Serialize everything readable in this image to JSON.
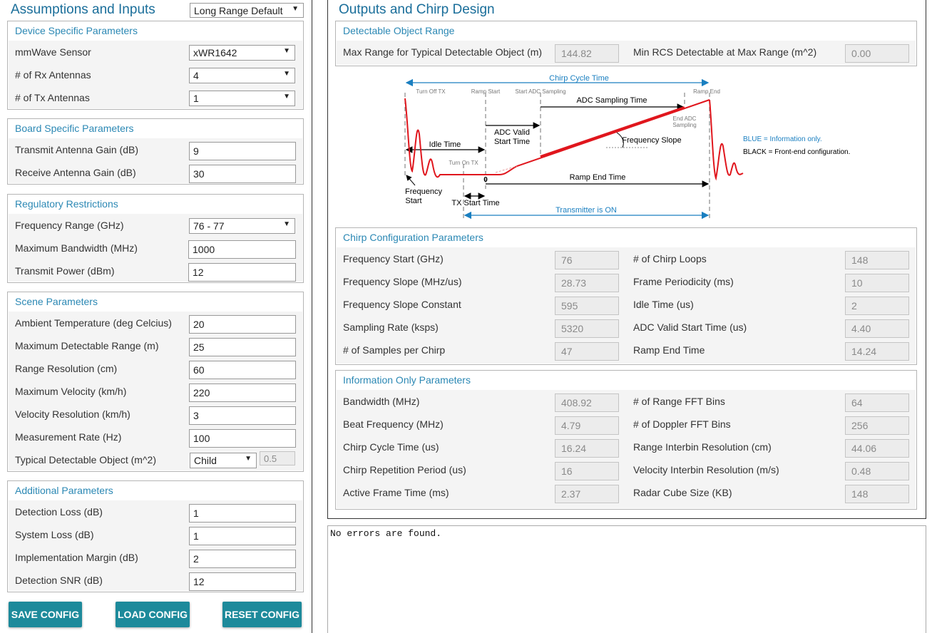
{
  "left": {
    "title": "Assumptions and Inputs",
    "preset": "Long Range Default",
    "device": {
      "title": "Device Specific Parameters",
      "sensor_label": "mmWave Sensor",
      "sensor": "xWR1642",
      "rx_label": "# of Rx Antennas",
      "rx": "4",
      "tx_label": "# of Tx Antennas",
      "tx": "1"
    },
    "board": {
      "title": "Board Specific Parameters",
      "tx_gain_label": "Transmit Antenna Gain (dB)",
      "tx_gain": "9",
      "rx_gain_label": "Receive Antenna Gain (dB)",
      "rx_gain": "30"
    },
    "regulatory": {
      "title": "Regulatory Restrictions",
      "freq_label": "Frequency Range (GHz)",
      "freq": "76 - 77",
      "bw_label": "Maximum Bandwidth (MHz)",
      "bw": "1000",
      "power_label": "Transmit Power (dBm)",
      "power": "12"
    },
    "scene": {
      "title": "Scene Parameters",
      "temp_label": "Ambient Temperature (deg Celcius)",
      "temp": "20",
      "range_label": "Maximum Detectable Range (m)",
      "range": "25",
      "res_label": "Range Resolution (cm)",
      "res": "60",
      "vel_label": "Maximum Velocity (km/h)",
      "vel": "220",
      "velres_label": "Velocity Resolution (km/h)",
      "velres": "3",
      "rate_label": "Measurement Rate (Hz)",
      "rate": "100",
      "obj_label": "Typical Detectable Object (m^2)",
      "obj": "Child",
      "obj_rcs": "0.5"
    },
    "additional": {
      "title": "Additional Parameters",
      "det_loss_label": "Detection Loss (dB)",
      "det_loss": "1",
      "sys_loss_label": "System Loss (dB)",
      "sys_loss": "1",
      "impl_label": "Implementation Margin (dB)",
      "impl": "2",
      "snr_label": "Detection SNR (dB)",
      "snr": "12"
    },
    "buttons": {
      "save": "SAVE CONFIG",
      "load": "LOAD CONFIG",
      "reset": "RESET CONFIG"
    }
  },
  "right": {
    "title": "Outputs and Chirp Design",
    "range": {
      "title": "Detectable Object Range",
      "max_range_label": "Max Range for Typical Detectable Object (m)",
      "max_range": "144.82",
      "min_rcs_label": "Min RCS Detectable at Max Range (m^2)",
      "min_rcs": "0.00"
    },
    "diagram": {
      "chirp_cycle": "Chirp Cycle Time",
      "turn_off_tx": "Turn Off TX",
      "ramp_start": "Ramp Start",
      "start_adc": "Start ADC Sampling",
      "ramp_end": "Ramp End",
      "adc_sampling": "ADC Sampling Time",
      "end_adc_1": "End ADC",
      "end_adc_2": "Sampling",
      "adc_valid_1": "ADC Valid",
      "adc_valid_2": "Start Time",
      "idle_time": "Idle Time",
      "freq_slope": "Frequency Slope",
      "turn_on_tx": "Turn On TX",
      "zero": "0",
      "ramp_end_time": "Ramp End Time",
      "freq_start_1": "Frequency",
      "freq_start_2": "Start",
      "tx_start": "TX Start Time",
      "tx_on": "Transmitter is ON",
      "legend_blue": "BLUE = Information only.",
      "legend_black": "BLACK = Front-end configuration.",
      "colors": {
        "blue": "#1a7fc0",
        "red": "#e0161d"
      }
    },
    "chirp": {
      "title": "Chirp Configuration Parameters",
      "rows": [
        {
          "l1": "Frequency Start (GHz)",
          "v1": "76",
          "l2": "# of Chirp Loops",
          "v2": "148"
        },
        {
          "l1": "Frequency Slope (MHz/us)",
          "v1": "28.73",
          "l2": "Frame Periodicity (ms)",
          "v2": "10"
        },
        {
          "l1": "Frequency Slope Constant",
          "v1": "595",
          "l2": "Idle Time (us)",
          "v2": "2"
        },
        {
          "l1": "Sampling Rate (ksps)",
          "v1": "5320",
          "l2": "ADC Valid Start Time (us)",
          "v2": "4.40"
        },
        {
          "l1": "# of Samples per Chirp",
          "v1": "47",
          "l2": "Ramp End Time",
          "v2": "14.24"
        }
      ]
    },
    "info": {
      "title": "Information Only Parameters",
      "rows": [
        {
          "l1": "Bandwidth (MHz)",
          "v1": "408.92",
          "l2": "# of Range FFT Bins",
          "v2": "64"
        },
        {
          "l1": "Beat Frequency (MHz)",
          "v1": "4.79",
          "l2": "# of Doppler FFT Bins",
          "v2": "256"
        },
        {
          "l1": "Chirp Cycle Time (us)",
          "v1": "16.24",
          "l2": "Range Interbin Resolution (cm)",
          "v2": "44.06"
        },
        {
          "l1": "Chirp Repetition Period (us)",
          "v1": "16",
          "l2": "Velocity Interbin Resolution (m/s)",
          "v2": "0.48"
        },
        {
          "l1": "Active Frame Time (ms)",
          "v1": "2.37",
          "l2": "Radar Cube Size (KB)",
          "v2": "148"
        }
      ]
    },
    "console": "No errors are found."
  }
}
